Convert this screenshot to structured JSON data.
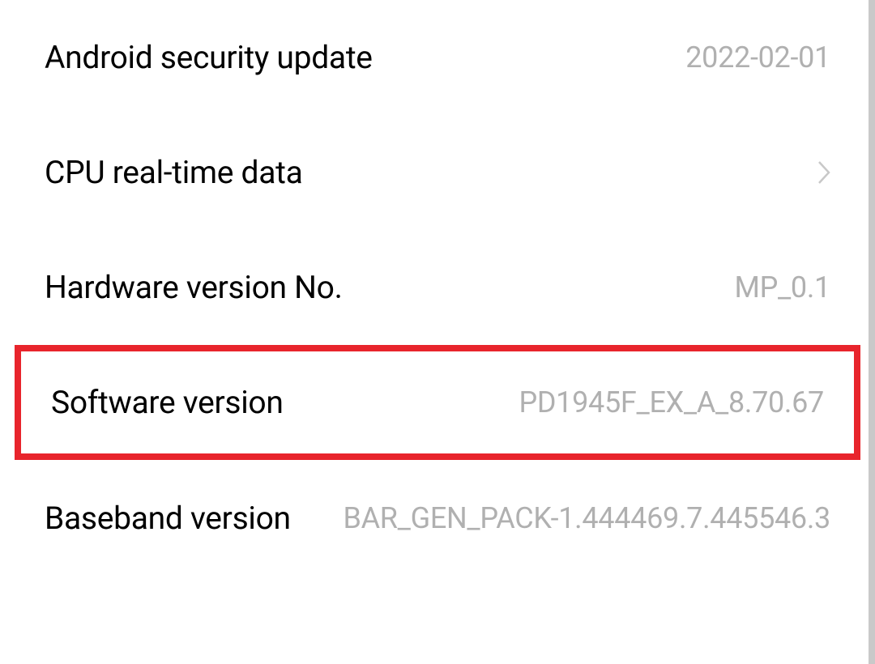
{
  "settings": {
    "items": [
      {
        "label": "Android security update",
        "value": "2022-02-01"
      },
      {
        "label": "CPU real-time data",
        "value": ""
      },
      {
        "label": "Hardware version No.",
        "value": "MP_0.1"
      },
      {
        "label": "Software version",
        "value": "PD1945F_EX_A_8.70.67"
      },
      {
        "label": "Baseband version",
        "value": "BAR_GEN_PACK-1.444469.7.445546.3"
      }
    ]
  }
}
